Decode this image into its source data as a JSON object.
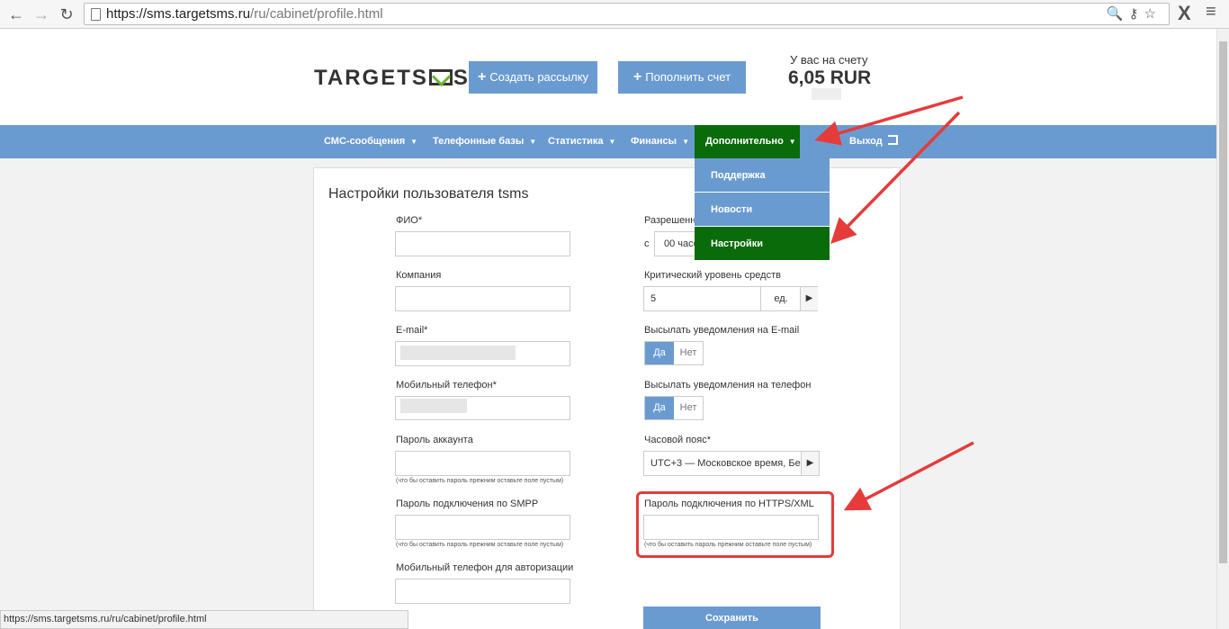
{
  "browser": {
    "url_host": "https://sms.targetsms.ru",
    "url_path": "/ru/cabinet/profile.html"
  },
  "header": {
    "logo_text_a": "TARGETS",
    "logo_text_b": "S",
    "create_button": "Создать рассылку",
    "topup_button": "Пополнить счет",
    "balance_label": "У вас на счету",
    "balance_value": "6,05 RUR"
  },
  "nav": {
    "items": [
      "СМС-сообщения",
      "Телефонные базы",
      "Статистика",
      "Финансы",
      "Дополнительно"
    ],
    "logout": "Выход"
  },
  "dropdown": {
    "items": [
      "Поддержка",
      "Новости",
      "Настройки"
    ]
  },
  "form": {
    "title": "Настройки пользователя tsms",
    "left": {
      "fio_label": "ФИО*",
      "company_label": "Компания",
      "email_label": "E-mail*",
      "phone_label": "Мобильный телефон*",
      "account_password_label": "Пароль аккаунта",
      "smpp_password_label": "Пароль подключения по SMPP",
      "auth_phone_label": "Мобильный телефон для авторизации",
      "hint": "(что бы оставить пароль прежним оставьте поле пустым)"
    },
    "right": {
      "allowed_label": "Разрешенн",
      "from_label": "с",
      "from_value": "00 часо",
      "critical_label": "Критический уровень средств",
      "critical_value": "5",
      "critical_unit": "ед.",
      "email_notify_label": "Высылать уведомления на E-mail",
      "phone_notify_label": "Высылать уведомления на телефон",
      "yes": "Да",
      "no": "Нет",
      "timezone_label": "Часовой пояс*",
      "timezone_value": "UTC+3 — Московское время, Бе",
      "https_password_label": "Пароль подключения по HTTPS/XML",
      "hint": "(что бы оставить пароль прежним оставьте поле пустым)",
      "save_button": "Сохранить"
    }
  },
  "status_bar": "https://sms.targetsms.ru/ru/cabinet/profile.html",
  "colors": {
    "nav_blue": "#6a9bd0",
    "active_green": "#0a6b0a",
    "annotation_red": "#e53b3b"
  }
}
